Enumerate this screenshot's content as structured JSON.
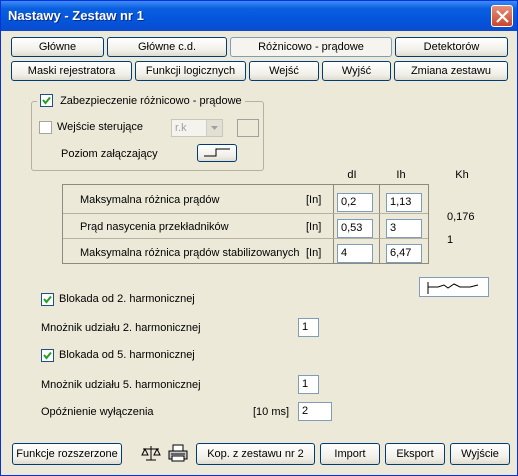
{
  "window": {
    "title": "Nastawy  -  Zestaw nr 1"
  },
  "tabs_row1": [
    {
      "label": "Główne"
    },
    {
      "label": "Główne c.d."
    },
    {
      "label": "Różnicowo - prądowe"
    },
    {
      "label": "Detektorów"
    }
  ],
  "tabs_row2": [
    {
      "label": "Maski rejestratora"
    },
    {
      "label": "Funkcji logicznych"
    },
    {
      "label": "Wejść"
    },
    {
      "label": "Wyjść"
    },
    {
      "label": "Zmiana zestawu"
    }
  ],
  "protection": {
    "label": "Zabezpieczenie różnicowo - prądowe",
    "checked": true,
    "control_input_label": "Wejście sterujące",
    "control_input_value": "r.k",
    "activation_level_label": "Poziom załączający"
  },
  "params": {
    "headers": {
      "dI": "dI",
      "Ih": "Ih",
      "Kh": "Kh"
    },
    "rows": [
      {
        "label": "Maksymalna różnica prądów",
        "unit": "[In]",
        "dI": "0,2",
        "Ih": "1,13",
        "Kh": "0,176"
      },
      {
        "label": "Prąd nasycenia przekładników",
        "unit": "[In]",
        "dI": "0,53",
        "Ih": "3",
        "Kh": "1"
      },
      {
        "label": "Maksymalna różnica prądów stabilizowanych",
        "unit": "[In]",
        "dI": "4",
        "Ih": "6,47",
        "Kh": ""
      }
    ]
  },
  "harmonics": {
    "h2_block_label": "Blokada od 2. harmonicznej",
    "h2_multiplier_label": "Mnożnik udziału 2. harmonicznej",
    "h2_multiplier_value": "1",
    "h5_block_label": "Blokada od 5. harmonicznej",
    "h5_multiplier_label": "Mnożnik udziału 5. harmonicznej",
    "h5_multiplier_value": "1",
    "trip_delay_label": "Opóźnienie wyłączenia",
    "trip_delay_unit": "[10 ms]",
    "trip_delay_value": "2"
  },
  "footer": {
    "extended": "Funkcje rozszerzone",
    "copy": "Kop. z zestawu nr 2",
    "import": "Import",
    "export": "Eksport",
    "exit": "Wyjście",
    "icons": [
      "scales-icon",
      "printer-icon"
    ]
  },
  "colors": {
    "titlebar": "#0456dc",
    "background": "#ece9d8",
    "button_border": "#003c74"
  }
}
